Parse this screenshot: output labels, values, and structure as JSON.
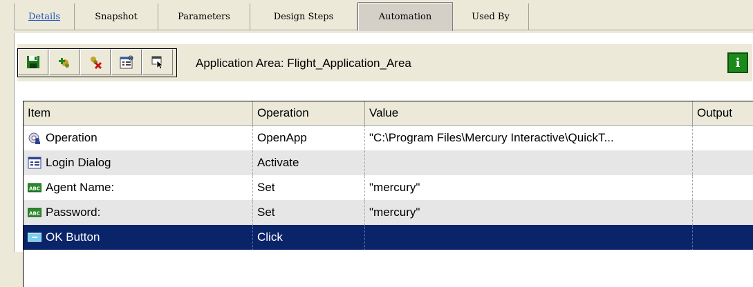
{
  "tabs": [
    {
      "label": "Details"
    },
    {
      "label": "Snapshot"
    },
    {
      "label": "Parameters"
    },
    {
      "label": "Design Steps"
    },
    {
      "label": "Automation"
    },
    {
      "label": "Used By"
    }
  ],
  "active_tab": "Automation",
  "toolbar": {
    "application_area_text": "Application Area: Flight_Application_Area",
    "info_label": "i",
    "icons": [
      "save-icon",
      "add-item-icon",
      "delete-item-icon",
      "properties-icon",
      "select-object-icon"
    ]
  },
  "grid": {
    "columns": [
      "Item",
      "Operation",
      "Value",
      "Output"
    ],
    "rows": [
      {
        "icon": "operation-icon",
        "item": "Operation",
        "operation": "OpenApp",
        "value": "\"C:\\Program Files\\Mercury Interactive\\QuickT...",
        "output": ""
      },
      {
        "icon": "dialog-icon",
        "item": "Login Dialog",
        "operation": "Activate",
        "value": "",
        "output": ""
      },
      {
        "icon": "edit-field-icon",
        "item": "Agent Name:",
        "operation": "Set",
        "value": "\"mercury\"",
        "output": ""
      },
      {
        "icon": "edit-field-icon",
        "item": "Password:",
        "operation": "Set",
        "value": "\"mercury\"",
        "output": ""
      },
      {
        "icon": "button-icon",
        "item": "OK Button",
        "operation": "Click",
        "value": "",
        "output": ""
      }
    ],
    "selected_row": 4
  },
  "colors": {
    "selection": "#0a246a",
    "tab_link": "#1d4fbf",
    "info_button": "#1b8a1b"
  }
}
